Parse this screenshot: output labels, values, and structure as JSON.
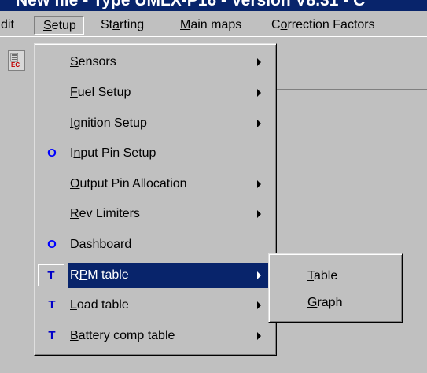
{
  "window": {
    "title": "New file - Type UMLX-P16 - Version V8.31 - C"
  },
  "menubar": {
    "items": [
      {
        "pre": "",
        "u": "",
        "post": "dit"
      },
      {
        "pre": "",
        "u": "S",
        "post": "etup"
      },
      {
        "pre": "St",
        "u": "a",
        "post": "rting"
      },
      {
        "pre": "",
        "u": "M",
        "post": "ain maps"
      },
      {
        "pre": "C",
        "u": "o",
        "post": "rrection Factors"
      }
    ]
  },
  "toolbar": {
    "icon_label": "EC"
  },
  "setup_menu": {
    "items": [
      {
        "glyph": "",
        "pre": "",
        "u": "S",
        "post": "ensors",
        "submenu": true
      },
      {
        "glyph": "",
        "pre": "",
        "u": "F",
        "post": "uel Setup",
        "submenu": true
      },
      {
        "glyph": "",
        "pre": "",
        "u": "I",
        "post": "gnition Setup",
        "submenu": true
      },
      {
        "glyph": "O",
        "pre": "I",
        "u": "n",
        "post": "put Pin Setup",
        "submenu": false
      },
      {
        "glyph": "",
        "pre": "",
        "u": "O",
        "post": "utput Pin Allocation",
        "submenu": true
      },
      {
        "glyph": "",
        "pre": "",
        "u": "R",
        "post": "ev Limiters",
        "submenu": true
      },
      {
        "glyph": "O",
        "pre": "",
        "u": "D",
        "post": "ashboard",
        "submenu": false
      },
      {
        "glyph": "T",
        "pre": "R",
        "u": "P",
        "post": "M table",
        "submenu": true
      },
      {
        "glyph": "T",
        "pre": "",
        "u": "L",
        "post": "oad table",
        "submenu": true
      },
      {
        "glyph": "T",
        "pre": "",
        "u": "B",
        "post": "attery comp table",
        "submenu": true
      }
    ]
  },
  "rpm_submenu": {
    "items": [
      {
        "pre": "",
        "u": "T",
        "post": "able"
      },
      {
        "pre": "",
        "u": "G",
        "post": "raph"
      }
    ]
  },
  "colors": {
    "highlight": "#08246b",
    "face": "#c0c0c0",
    "glyph_o": "#0000ff",
    "glyph_t": "#0000c8"
  }
}
